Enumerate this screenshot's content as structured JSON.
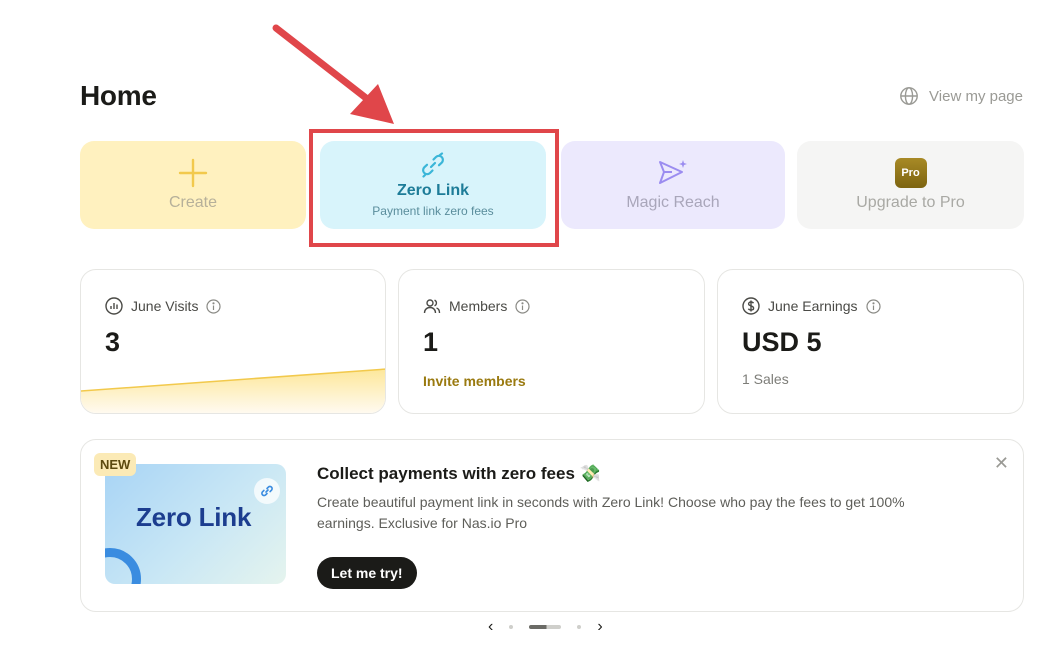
{
  "page": {
    "title": "Home",
    "view_my_page": "View my page"
  },
  "quick_actions": [
    {
      "label": "Create",
      "icon": "plus-icon",
      "color": "#fff1bf"
    },
    {
      "label": "Zero Link",
      "subtitle": "Payment link zero fees",
      "icon": "link-icon",
      "color": "#d8f4fb"
    },
    {
      "label": "Magic Reach",
      "icon": "send-sparkle-icon",
      "color": "#ece9fd"
    },
    {
      "label": "Upgrade to Pro",
      "badge": "Pro",
      "icon": "pro-badge-icon",
      "color": "#f5f5f4"
    }
  ],
  "stats": {
    "visits": {
      "label": "June Visits",
      "value": "3",
      "icon": "bar-chart-icon"
    },
    "members": {
      "label": "Members",
      "value": "1",
      "link": "Invite members",
      "icon": "people-icon"
    },
    "earnings": {
      "label": "June Earnings",
      "value": "USD 5",
      "sub": "1 Sales",
      "icon": "dollar-circle-icon"
    }
  },
  "banner": {
    "badge": "NEW",
    "image_title": "Zero Link",
    "title": "Collect payments with zero fees 💸",
    "text": "Create beautiful payment link in seconds with Zero Link! Choose who pay the fees to get 100% earnings. Exclusive for Nas.io Pro",
    "cta": "Let me try!"
  },
  "carousel": {
    "prev": "‹",
    "next": "›",
    "active_index": 1,
    "total": 3
  },
  "annotation": {
    "highlight_color": "#e0464a"
  }
}
